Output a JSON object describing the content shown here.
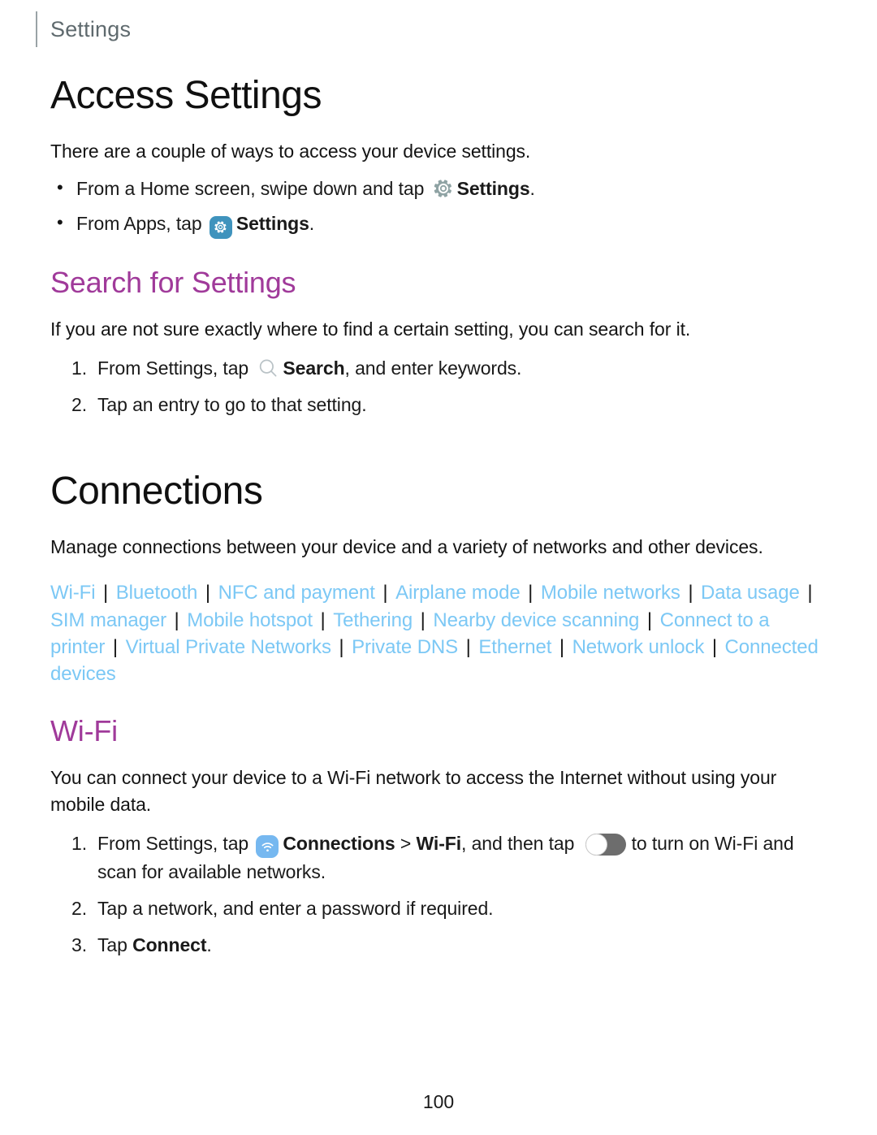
{
  "header": {
    "title": "Settings"
  },
  "sections": {
    "access_settings": {
      "heading": "Access Settings",
      "intro": "There are a couple of ways to access your device settings.",
      "bullets": [
        {
          "pre": "From a Home screen, swipe down and tap",
          "icon": "gear-icon",
          "bold": "Settings",
          "post": "."
        },
        {
          "pre": "From Apps, tap",
          "icon": "settings-app-icon",
          "bold": "Settings",
          "post": "."
        }
      ]
    },
    "search_for_settings": {
      "heading": "Search for Settings",
      "intro": "If you are not sure exactly where to find a certain setting, you can search for it.",
      "steps": [
        {
          "num": "1.",
          "pre": "From Settings, tap",
          "icon": "search-icon",
          "bold": "Search",
          "post": ", and enter keywords."
        },
        {
          "num": "2.",
          "text": "Tap an entry to go to that setting."
        }
      ]
    },
    "connections": {
      "heading": "Connections",
      "intro": "Manage connections between your device and a variety of networks and other devices.",
      "links": [
        "Wi-Fi",
        "Bluetooth",
        "NFC and payment",
        "Airplane mode",
        "Mobile networks",
        "Data usage",
        "SIM manager",
        "Mobile hotspot",
        "Tethering",
        "Nearby device scanning",
        "Connect to a printer",
        "Virtual Private Networks",
        "Private DNS",
        "Ethernet",
        "Network unlock",
        "Connected devices"
      ],
      "link_separator": "|"
    },
    "wifi": {
      "heading": "Wi-Fi",
      "intro": "You can connect your device to a Wi-Fi network to access the Internet without using your mobile data.",
      "steps": [
        {
          "num": "1.",
          "pre": "From Settings, tap",
          "icon": "wifi-app-icon",
          "bold1": "Connections",
          "mid1": " > ",
          "bold2": "Wi-Fi",
          "mid2": ", and then tap",
          "toggle": "toggle-switch-off",
          "post": "to turn on Wi-Fi and scan for available networks."
        },
        {
          "num": "2.",
          "text": "Tap a network, and enter a password if required."
        },
        {
          "num": "3.",
          "pre": "Tap",
          "bold": "Connect",
          "post": "."
        }
      ]
    }
  },
  "footer": {
    "page_number": "100"
  },
  "colors": {
    "heading_accent": "#a03a9a",
    "link": "#7cc8f5",
    "header_text": "#5f6a6e",
    "gear_gray": "#8fa3a4",
    "settings_app_bg": "#3f93bd",
    "wifi_app_bg": "#76b8f0",
    "toggle_track": "#6d6d6d"
  }
}
